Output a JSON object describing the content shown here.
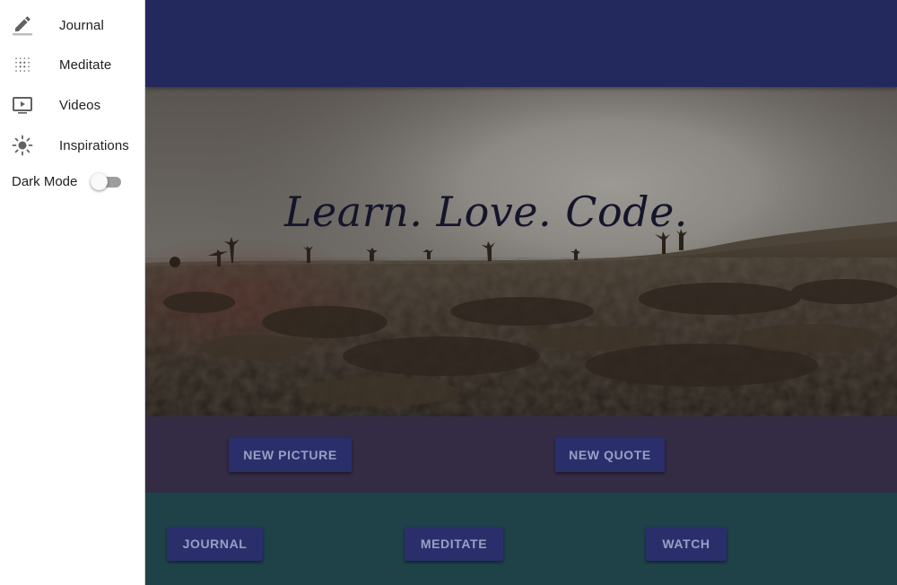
{
  "drawer": {
    "items": [
      {
        "label": "Journal",
        "icon": "pencil-icon"
      },
      {
        "label": "Meditate",
        "icon": "dot-grid-icon"
      },
      {
        "label": "Videos",
        "icon": "video-player-icon"
      },
      {
        "label": "Inspirations",
        "icon": "sun-icon"
      }
    ],
    "dark_mode": {
      "label": "Dark Mode",
      "enabled": false
    }
  },
  "hero": {
    "quote": "Learn. Love. Code."
  },
  "actions": {
    "new_picture": "NEW PICTURE",
    "new_quote": "NEW QUOTE"
  },
  "links": {
    "journal": "JOURNAL",
    "meditate": "MEDITATE",
    "watch": "WATCH"
  },
  "colors": {
    "app_bar": "#23295c",
    "button": "#2a2f6c",
    "strip_one": "#342b44",
    "strip_two": "#1e4248"
  }
}
